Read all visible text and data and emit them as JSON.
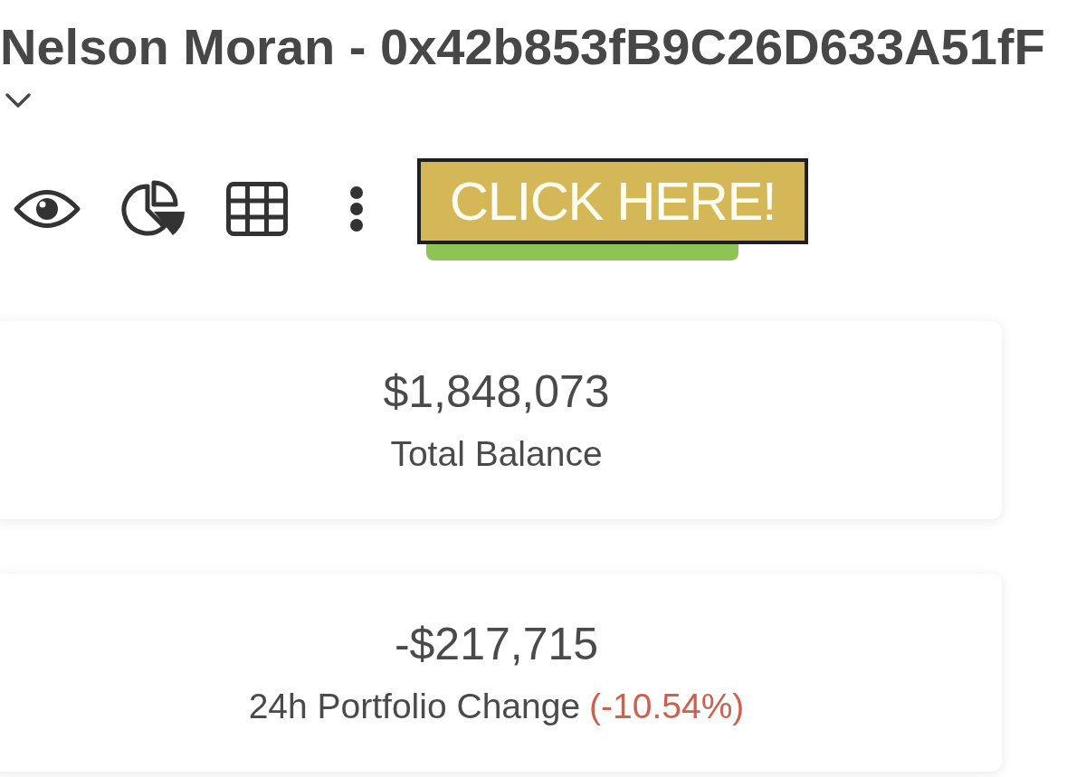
{
  "header": {
    "title": "Nelson Moran - 0x42b853fB9C26D633A51fF"
  },
  "toolbar": {
    "cta": {
      "label": "CLICK HERE!"
    }
  },
  "cards": [
    {
      "value": "$1,848,073",
      "label": "Total Balance"
    },
    {
      "value": "-$217,715",
      "label": "24h Portfolio Change",
      "change": {
        "text": "(-10.54%)",
        "negative": true
      }
    }
  ]
}
